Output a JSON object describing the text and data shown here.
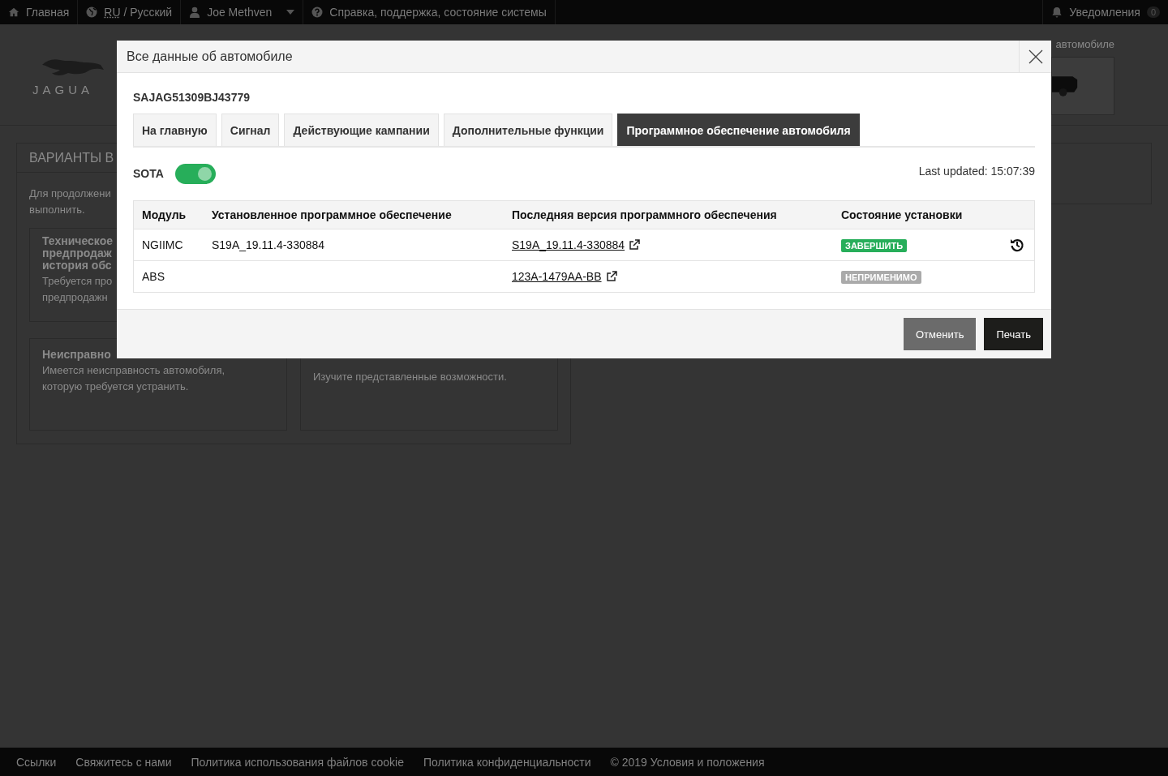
{
  "top_nav": {
    "items": [
      {
        "kind": "home",
        "label": "Главная"
      },
      {
        "kind": "language",
        "code": "RU",
        "label": "/ Русский"
      },
      {
        "kind": "user",
        "label": "Joe Methven"
      },
      {
        "kind": "help",
        "label": "Справка, поддержка, состояние системы"
      }
    ],
    "notifications": {
      "label": "Уведомления",
      "count": "0"
    }
  },
  "header": {
    "logo_text": "JAGUA",
    "vehicle_caption": "автомобиле"
  },
  "options_panel": {
    "title": "ВАРИАНТЫ В",
    "intro": [
      "Для продолжени",
      "выполнить."
    ],
    "cards": [
      {
        "title": [
          "Техническое",
          "предпродаж",
          "история обс"
        ],
        "text": [
          "Требуется про",
          "предпродажн"
        ]
      },
      {
        "title": [
          "Неисправно"
        ],
        "text": [
          "Имеется неисправность автомобиля,",
          "которую требуется устранить."
        ]
      },
      {
        "text": [
          "Изучите представленные возможности."
        ]
      }
    ]
  },
  "modal": {
    "title": "Все данные об автомобиле",
    "vin": "SAJAG51309BJ43779",
    "tabs": [
      {
        "label": "На главную",
        "selected": false
      },
      {
        "label": "Сигнал",
        "selected": false
      },
      {
        "label": "Действующие кампании",
        "selected": false
      },
      {
        "label": "Дополнительные функции",
        "selected": false
      },
      {
        "label": "Программное обеспечение автомобиля",
        "selected": true
      }
    ],
    "sota": {
      "label": "SOTA",
      "on": true
    },
    "last_updated": "Last updated: 15:07:39",
    "table": {
      "columns": [
        "Модуль",
        "Установленное программное обеспечение",
        "Последняя версия программного обеспечения",
        "Состояние установки"
      ],
      "rows": [
        {
          "module": "NGIIMC",
          "installed": "S19A_19.11.4-330884",
          "latest": "S19A_19.11.4-330884",
          "status": "ЗАВЕРШИТЬ",
          "color": "#27ae5a",
          "history": true
        },
        {
          "module": "ABS",
          "latest": "123A-1479AA-BB",
          "status": "НЕПРИМЕНИМО",
          "color": "#aaaaaa",
          "history": false
        }
      ]
    },
    "buttons": [
      {
        "label": "Отменить",
        "kind": "secondary"
      },
      {
        "label": "Печать",
        "kind": "primary"
      }
    ]
  },
  "footer": {
    "links": [
      "Ссылки",
      "Свяжитесь с нами",
      "Политика использования файлов cookie",
      "Политика конфиденциальности",
      "© 2019 Условия и положения"
    ]
  }
}
